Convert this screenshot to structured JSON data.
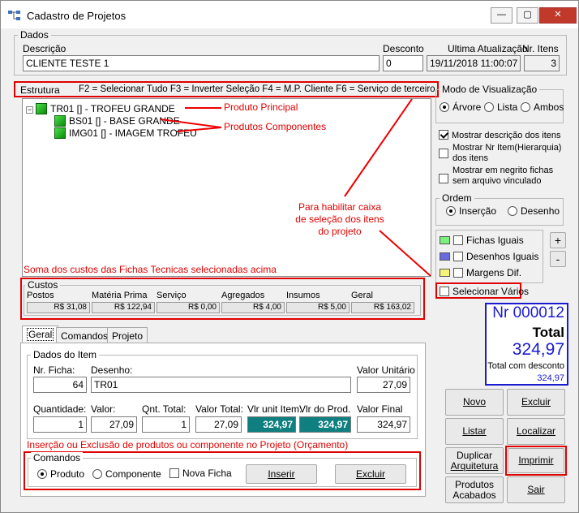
{
  "window": {
    "title": "Cadastro de Projetos"
  },
  "dados": {
    "label": "Dados",
    "descricao_label": "Descrição",
    "descricao": "CLIENTE TESTE 1",
    "desconto_label": "Desconto",
    "desconto": "0",
    "ultima_label": "Ultima Atualização",
    "ultima": "19/11/2018 11:00:07",
    "nr_itens_label": "Nr. Itens",
    "nr_itens": "3"
  },
  "estrutura": {
    "label": "Estrutura",
    "hint": "F2 = Selecionar Tudo   F3 = Inverter Seleção   F4 = M.P. Cliente   F6 = Serviço de terceiro"
  },
  "tree": [
    {
      "code": "TR01 []",
      "desc": " - TROFEU GRANDE"
    },
    {
      "code": "BS01 []",
      "desc": " - BASE GRANDE"
    },
    {
      "code": "IMG01 []",
      "desc": " - IMAGEM TROFEU"
    }
  ],
  "annotations": {
    "produto_principal": "Produto Principal",
    "produtos_componentes": "Produtos Componentes",
    "habilitar": [
      "Para habilitar caixa",
      "de seleção dos itens",
      "do projeto"
    ],
    "soma": "Soma dos custos das Fichas Tecnicas selecionadas acima",
    "insercao": "Inserção ou Exclusão de produtos ou componente no Projeto (Orçamento)"
  },
  "custos": {
    "label": "Custos",
    "cols": [
      {
        "label": "Postos",
        "value": "R$ 31,08"
      },
      {
        "label": "Matéria Prima",
        "value": "R$ 122,94"
      },
      {
        "label": "Serviço",
        "value": "R$ 0,00"
      },
      {
        "label": "Agregados",
        "value": "R$ 4,00"
      },
      {
        "label": "Insumos",
        "value": "R$ 5,00"
      },
      {
        "label": "Geral",
        "value": "R$ 163,02"
      }
    ]
  },
  "tabs": [
    "Geral",
    "Comandos",
    "Projeto"
  ],
  "item": {
    "label": "Dados do Item",
    "nr_ficha_label": "Nr. Ficha:",
    "nr_ficha": "64",
    "desenho_label": "Desenho:",
    "desenho": "TR01",
    "valor_unit_label": "Valor Unitário",
    "valor_unit": "27,09",
    "quantidade_label": "Quantidade:",
    "quantidade": "1",
    "valor_label": "Valor:",
    "valor": "27,09",
    "qnt_total_label": "Qnt. Total:",
    "qnt_total": "1",
    "valor_total_label": "Valor Total:",
    "valor_total": "27,09",
    "vlr_unit_item_label": "Vlr unit Item:",
    "vlr_unit_item": "324,97",
    "vlr_prod_label": "Vlr do Prod.",
    "vlr_prod": "324,97",
    "valor_final_label": "Valor Final",
    "valor_final": "324,97"
  },
  "comandos": {
    "label": "Comandos",
    "produto": "Produto",
    "componente": "Componente",
    "nova_ficha": "Nova Ficha",
    "inserir": "Inserir",
    "excluir": "Excluir"
  },
  "modo": {
    "label": "Modo de Visualização",
    "arvore": "Árvore",
    "lista": "Lista",
    "ambos": "Ambos"
  },
  "options": {
    "mostrar_desc": "Mostrar descrição dos itens",
    "mostrar_nr": [
      "Mostrar Nr Item(Hierarquia)",
      "dos itens"
    ],
    "mostrar_negrito": [
      "Mostrar em negrito fichas",
      "sem arquivo vinculado"
    ]
  },
  "ordem": {
    "label": "Ordem",
    "insercao": "Inserção",
    "desenho": "Desenho"
  },
  "legend": [
    {
      "label": "Fichas Iguais",
      "color": "#7cf07c"
    },
    {
      "label": "Desenhos Iguais",
      "color": "#6a6adf"
    },
    {
      "label": "Margens Dif.",
      "color": "#f4f47a"
    }
  ],
  "selecionar": "Selecionar Vários",
  "totals": {
    "nr": "Nr 000012",
    "total_label": "Total",
    "total": "324,97",
    "desc_label": "Total com desconto",
    "desc": "324,97"
  },
  "buttons": {
    "novo": "Novo",
    "excluir": "Excluir",
    "listar": "Listar",
    "localizar": "Localizar",
    "duplicar": [
      "Duplicar",
      "Arquitetura"
    ],
    "imprimir": "Imprimir",
    "produtos": [
      "Produtos",
      "Acabados"
    ],
    "sair": "Sair"
  }
}
